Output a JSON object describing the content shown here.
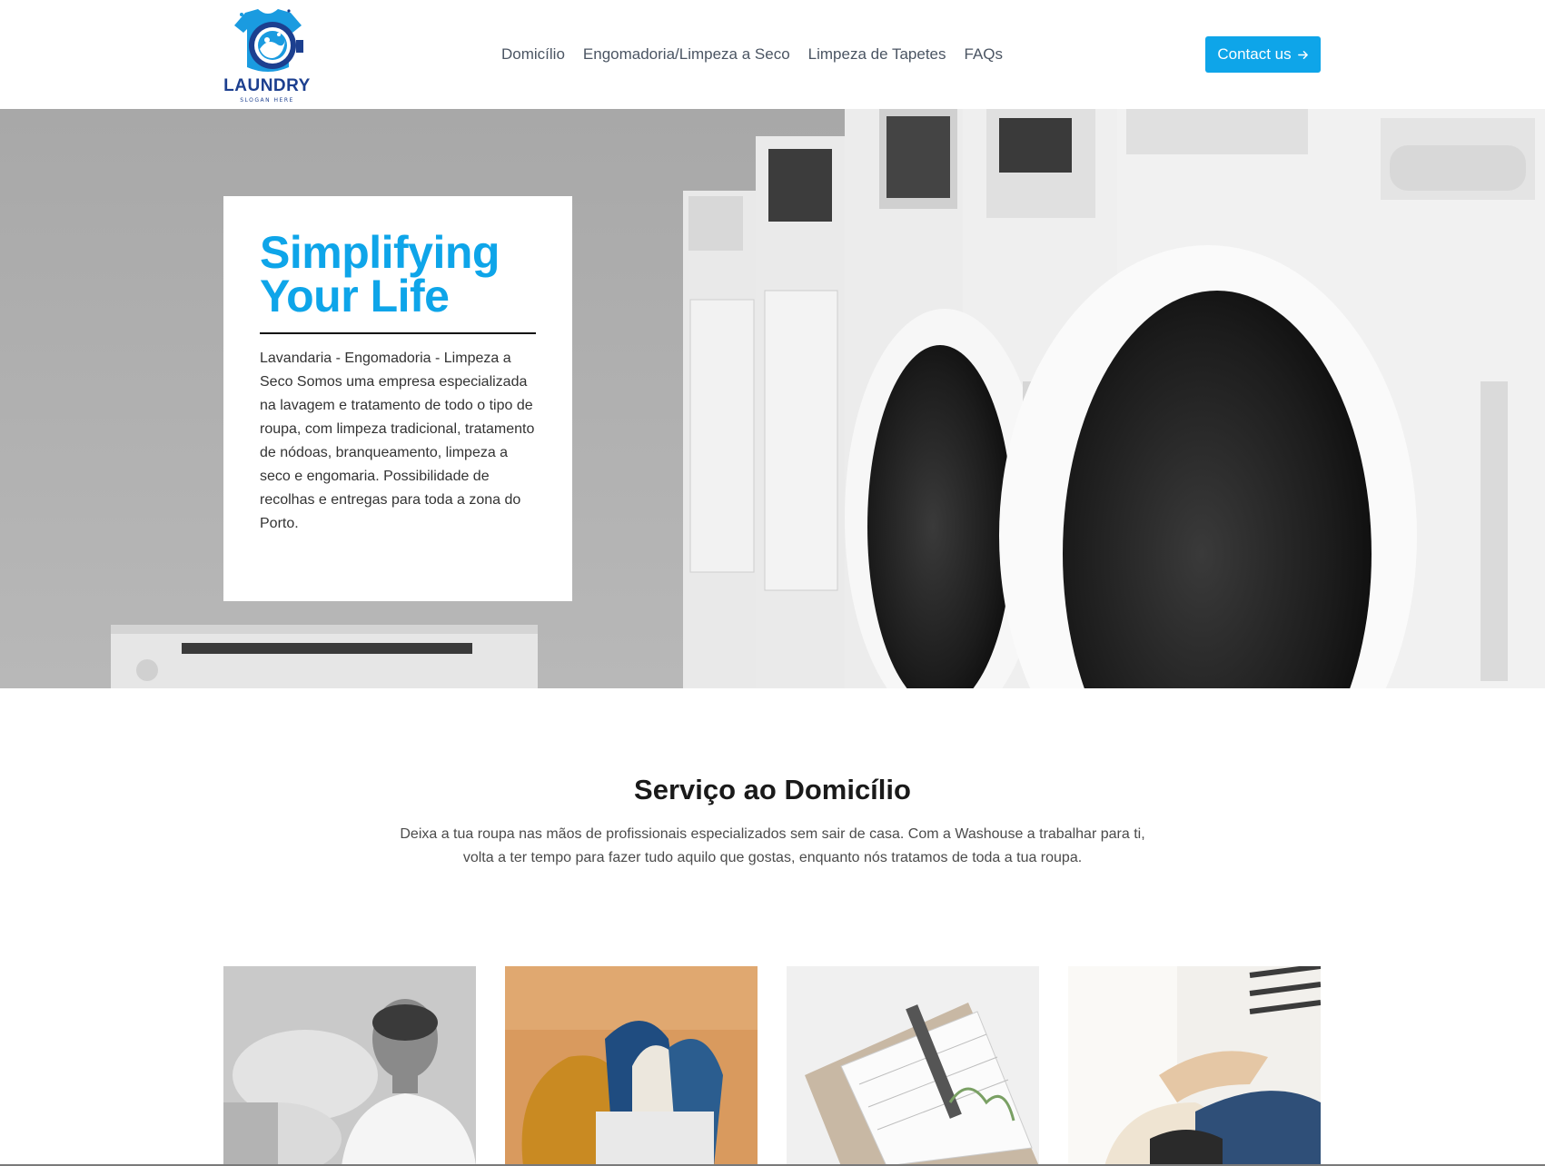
{
  "brand": {
    "name": "LAUNDRY",
    "slogan": "SLOGAN HERE",
    "colors": {
      "primary": "#1c3f8f",
      "accent": "#0ea5e9"
    }
  },
  "nav": {
    "items": [
      "Domicílio",
      "Engomadoria/Limpeza a Seco",
      "Limpeza de Tapetes",
      "FAQs"
    ]
  },
  "header": {
    "contact_label": "Contact us",
    "contact_icon": "arrow-right-icon"
  },
  "hero": {
    "title_line1": "Simplifying",
    "title_line2": "Your Life",
    "text": "Lavandaria - Engomadoria - Limpeza a Seco Somos uma empresa especializada na lavagem e tratamento de todo o tipo de roupa, com limpeza tradicional, tratamento de nódoas, branqueamento, limpeza a seco e engomaria. Possibilidade de recolhas e entregas para toda a zona do Porto.",
    "image": "laundromat-washing-machines-photo"
  },
  "services": {
    "title": "Serviço ao Domicílio",
    "text": "Deixa a tua roupa nas mãos de profissionais especializados sem sair de casa. Com a Washouse a trabalhar para ti, volta a ter tempo para fazer tudo aquilo que gostas, enquanto nós tratamos de toda a tua roupa.",
    "cards": [
      {
        "image": "smiling-laundry-worker-photo"
      },
      {
        "image": "folded-knit-clothes-basket-photo"
      },
      {
        "image": "planner-calendar-pen-photo"
      },
      {
        "image": "person-sorting-clothes-photo"
      }
    ]
  }
}
